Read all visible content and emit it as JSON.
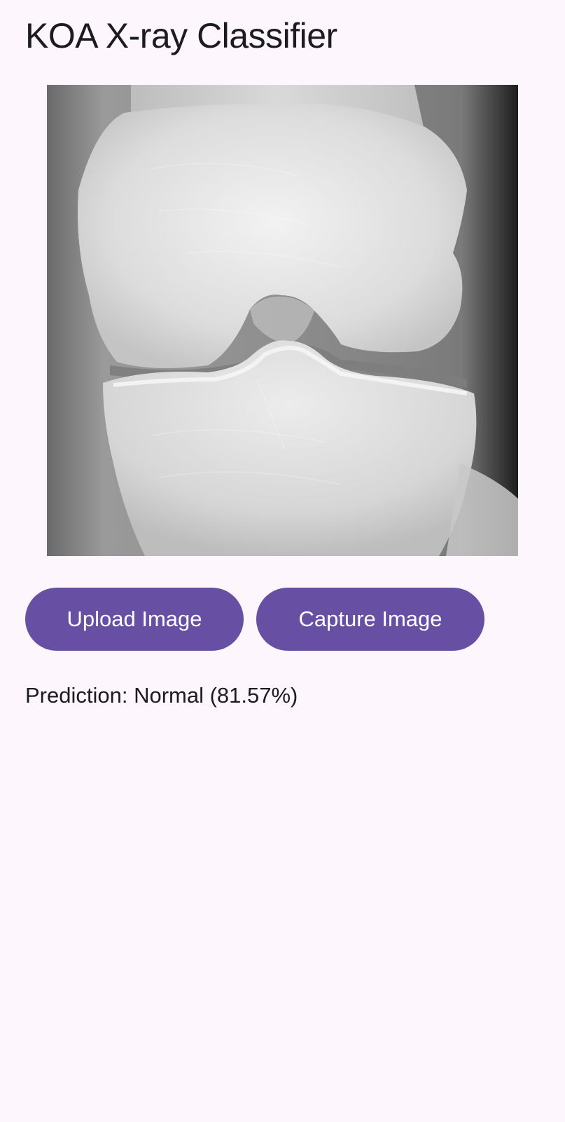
{
  "app": {
    "title": "KOA X-ray Classifier"
  },
  "image": {
    "description_icon": "knee-xray-image"
  },
  "actions": {
    "upload_label": "Upload Image",
    "capture_label": "Capture Image"
  },
  "result": {
    "prediction_text": "Prediction: Normal (81.57%)"
  },
  "colors": {
    "background": "#fdf7fd",
    "button": "#6750a4",
    "button_text": "#ffffff",
    "text": "#1c1b1f"
  }
}
